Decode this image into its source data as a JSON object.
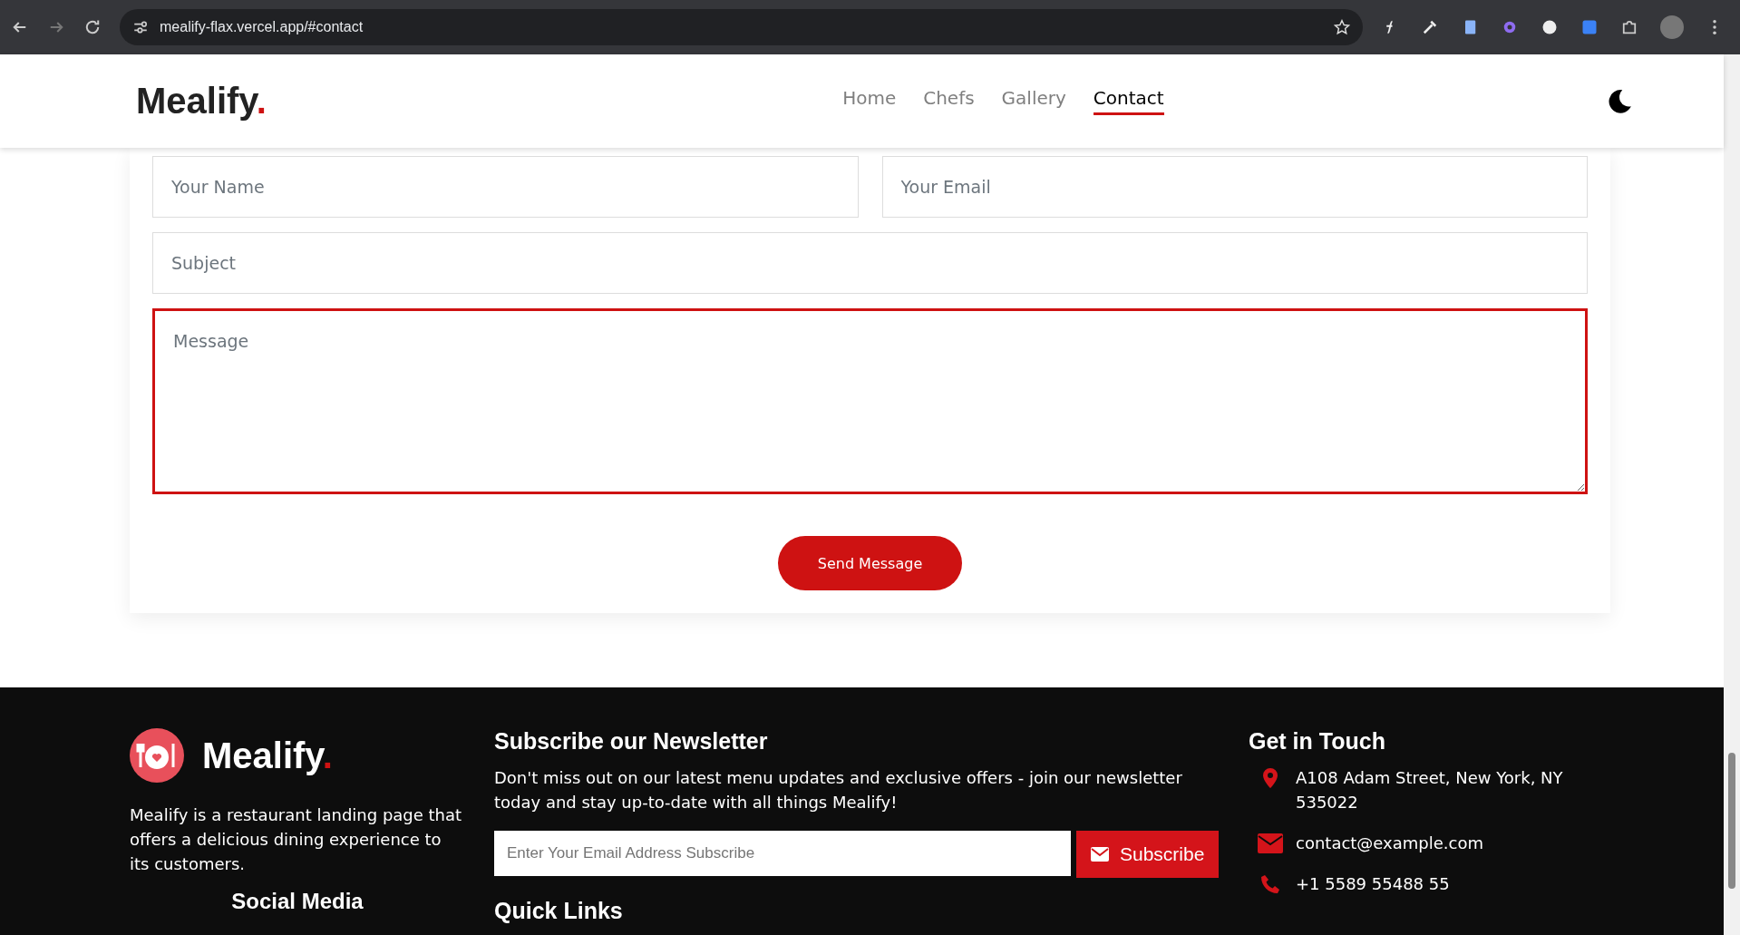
{
  "browser": {
    "url": "mealify-flax.vercel.app/#contact"
  },
  "header": {
    "logo": "Mealify",
    "logo_dot": ".",
    "nav": [
      {
        "label": "Home",
        "selected": false
      },
      {
        "label": "Chefs",
        "selected": false
      },
      {
        "label": "Gallery",
        "selected": false
      },
      {
        "label": "Contact",
        "selected": true
      }
    ]
  },
  "form": {
    "name_placeholder": "Your Name",
    "email_placeholder": "Your Email",
    "subject_placeholder": "Subject",
    "message_placeholder": "Message",
    "message_focused": true,
    "submit": "Send Message"
  },
  "footer": {
    "brand": {
      "logo": "Mealify",
      "logo_dot": ".",
      "description": "Mealify is a restaurant landing page that offers a delicious dining experience to its customers.",
      "social_heading": "Social Media"
    },
    "newsletter": {
      "heading": "Subscribe our Newsletter",
      "text": "Don't miss out on our latest menu updates and exclusive offers - join our newsletter today and stay up-to-date with all things Mealify!",
      "placeholder": "Enter Your Email Address Subscribe",
      "button": "Subscribe",
      "links_heading": "Quick Links"
    },
    "contact": {
      "heading": "Get in Touch",
      "items": [
        {
          "kind": "address",
          "text": "A108 Adam Street, New York, NY 535022"
        },
        {
          "kind": "email",
          "text": "contact@example.com"
        },
        {
          "kind": "phone",
          "text": "+1 5589 55488 55"
        }
      ]
    }
  }
}
